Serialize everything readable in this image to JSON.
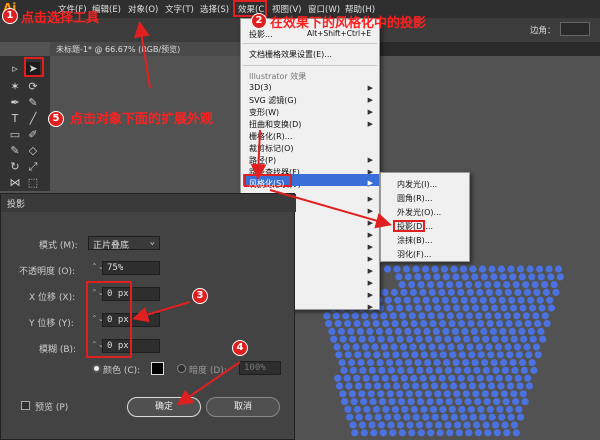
{
  "app": {
    "logo": "Ai"
  },
  "menubar": {
    "items": [
      "文件(F)",
      "编辑(E)",
      "对象(O)",
      "文字(T)",
      "选择(S)",
      "效果(C)",
      "视图(V)",
      "窗口(W)",
      "帮助(H)"
    ]
  },
  "optbar": {
    "corner_label": "边角："
  },
  "tab": {
    "title": "未标题-1* @ 66.67% (RGB/预览)"
  },
  "effect_menu": {
    "items": [
      {
        "label": "投影...",
        "shortcut": "Alt+Shift+Ctrl+E",
        "arrow": false
      },
      {
        "label": "文档栅格效果设置(E)...",
        "shortcut": "",
        "arrow": false
      },
      {
        "label": "Illustrator 效果",
        "shortcut": "",
        "arrow": false,
        "header": true
      },
      {
        "label": "3D(3)",
        "shortcut": "",
        "arrow": true
      },
      {
        "label": "SVG 滤镜(G)",
        "shortcut": "",
        "arrow": true
      },
      {
        "label": "变形(W)",
        "shortcut": "",
        "arrow": true
      },
      {
        "label": "扭曲和变换(D)",
        "shortcut": "",
        "arrow": true
      },
      {
        "label": "栅格化(R)...",
        "shortcut": "",
        "arrow": false
      },
      {
        "label": "裁剪标记(O)",
        "shortcut": "",
        "arrow": false
      },
      {
        "label": "路径(P)",
        "shortcut": "",
        "arrow": true
      },
      {
        "label": "路径查找器(F)",
        "shortcut": "",
        "arrow": true
      },
      {
        "label": "转换为形状(V)",
        "shortcut": "",
        "arrow": true
      },
      {
        "label": "风格化(S)",
        "shortcut": "",
        "arrow": true
      }
    ]
  },
  "stylize_submenu": {
    "items": [
      "内发光(I)...",
      "圆角(R)...",
      "外发光(O)...",
      "投影(D)...",
      "涂抹(B)...",
      "羽化(F)..."
    ]
  },
  "dialog": {
    "title": "投影",
    "mode_label": "模式 (M):",
    "mode_value": "正片叠底",
    "opacity_label": "不透明度 (O):",
    "opacity_value": "75%",
    "x_label": "X 位移 (X):",
    "x_value": "0 px",
    "y_label": "Y 位移 (Y):",
    "y_value": "0 px",
    "blur_label": "模糊 (B):",
    "blur_value": "0 px",
    "color_label": "颜色 (C):",
    "darkness_label": "暗度 (D):",
    "darkness_value": "100%",
    "preview_label": "预览 (P)",
    "ok_label": "确定",
    "cancel_label": "取消"
  },
  "annotations": {
    "n1": "1",
    "t1": "点击选择工具",
    "n2": "2",
    "t2": "在效果下的风格化中的投影",
    "n3": "3",
    "n4": "4",
    "n5": "5",
    "t5": "点击对象下面的扩展外观"
  },
  "colors": {
    "accent": "#3a6fd8",
    "annotation": "#e02020",
    "mesh": "#4a72e0"
  }
}
